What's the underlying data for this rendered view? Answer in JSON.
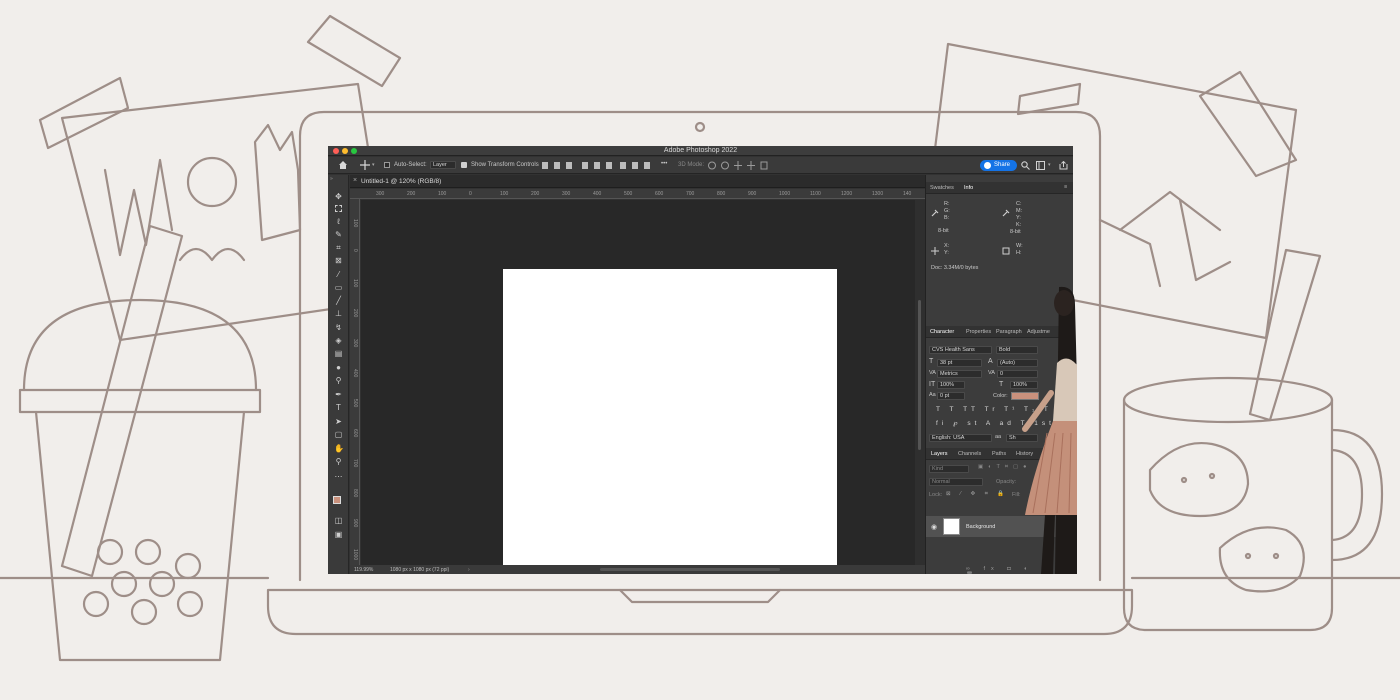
{
  "app": {
    "window_title": "Adobe Photoshop 2022",
    "home_icon": "home-icon"
  },
  "options_bar": {
    "auto_select_label": "Auto-Select:",
    "auto_select_value": "Layer",
    "auto_select_checked": false,
    "show_transform_label": "Show Transform Controls",
    "show_transform_checked": true,
    "more_label": "•••",
    "mode_3d_label": "3D Mode:",
    "share_label": "Share"
  },
  "document": {
    "tab_title": "Untitled-1 @ 120% (RGB/8)",
    "close_glyph": "×",
    "zoom": "119.99%",
    "doc_size": "1080 px x 1080 px (72 ppi)"
  },
  "rulers": {
    "top": [
      "300",
      "200",
      "100",
      "0",
      "100",
      "200",
      "300",
      "400",
      "500",
      "600",
      "700",
      "800",
      "900",
      "1000",
      "1100",
      "1200",
      "1300",
      "140"
    ],
    "left": [
      "100",
      "0",
      "100",
      "200",
      "300",
      "400",
      "500",
      "600",
      "700",
      "800",
      "900",
      "1000"
    ]
  },
  "info_panel": {
    "tabs": [
      "Swatches",
      "Info"
    ],
    "active_tab": "Info",
    "rgb_labels": [
      "R:",
      "G:",
      "B:"
    ],
    "cmyk_labels": [
      "C:",
      "M:",
      "Y:",
      "K:"
    ],
    "bit_left": "8-bit",
    "bit_right": "8-bit",
    "xy_labels": [
      "X:",
      "Y:"
    ],
    "wh_labels": [
      "W:",
      "H:"
    ],
    "doc_info": "Doc: 3.34M/0 bytes"
  },
  "character_panel": {
    "tabs": [
      "Character",
      "Properties",
      "Paragraph",
      "Adjustme"
    ],
    "active_tab": "Character",
    "font_family": "CVS Health Sans",
    "font_style": "Bold",
    "font_size": "38 pt",
    "leading": "(Auto)",
    "kerning": "Metrics",
    "tracking": "0",
    "vertical_scale": "100%",
    "horizontal_scale": "100%",
    "baseline_shift": "0 pt",
    "color_label": "Color:",
    "color_value": "#c9917d",
    "language": "English: USA",
    "anti_alias": "Sh"
  },
  "layers_panel": {
    "tabs": [
      "Layers",
      "Channels",
      "Paths",
      "History"
    ],
    "active_tab": "Layers",
    "kind_label": "Kind",
    "blend_mode": "Normal",
    "opacity_label": "Opacity:",
    "lock_label": "Lock:",
    "fill_label": "Fill:",
    "layers": [
      {
        "name": "Background",
        "visible": true
      }
    ]
  }
}
